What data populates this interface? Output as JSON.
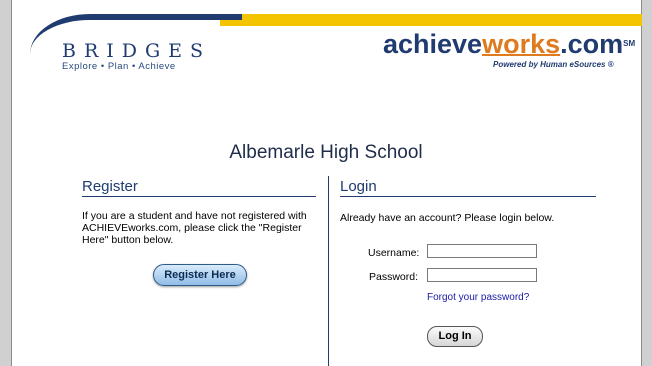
{
  "header": {
    "bridges_word": "BRIDGES",
    "bridges_tagline": "Explore • Plan • Achieve",
    "aw_achieve": "achieve",
    "aw_works": "works",
    "aw_com": ".com",
    "aw_sm": "SM",
    "aw_powered": "Powered by Human eSources ®"
  },
  "page": {
    "school_name": "Albemarle High School"
  },
  "register": {
    "heading": "Register",
    "text": "If you are a student and have not registered with ACHIEVEworks.com, please click the \"Register Here\" button below.",
    "button_label": "Register Here"
  },
  "login": {
    "heading": "Login",
    "intro": "Already have an account? Please login below.",
    "username_label": "Username:",
    "username_value": "",
    "password_label": "Password:",
    "password_value": "",
    "forgot_link": "Forgot your password?",
    "button_label": "Log In"
  },
  "colors": {
    "navy": "#1f3b70",
    "gold": "#f5c400",
    "orange": "#e07a1f"
  }
}
